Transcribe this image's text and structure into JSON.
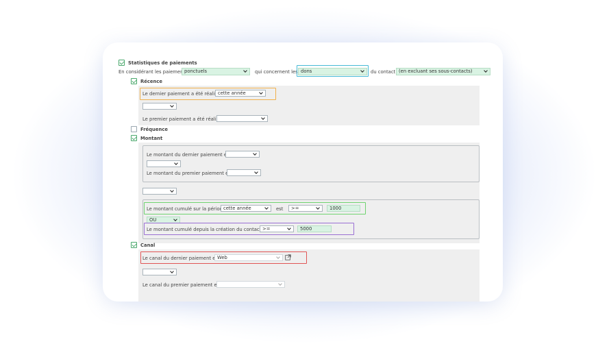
{
  "stats": {
    "title": "Statistiques de paiements",
    "checked": true
  },
  "filter": {
    "considering_label": "En considérant les paiements",
    "payments_value": "ponctuels",
    "concern_label": "qui concernent les",
    "concern_value": "dons",
    "contact_label": "du contact",
    "contact_value": "(en excluant ses sous-contacts)"
  },
  "recence": {
    "title": "Récence",
    "checked": true,
    "last_label": "Le dernier paiement a été réalisé",
    "last_value": "cette année",
    "op_value": "",
    "first_label": "Le premier paiement a été réalisé",
    "first_value": ""
  },
  "frequence": {
    "title": "Fréquence",
    "checked": false
  },
  "montant": {
    "title": "Montant",
    "checked": true,
    "last_label": "Le montant du dernier paiement est",
    "last_value": "",
    "op1_value": "",
    "first_label": "Le montant du premier paiement est",
    "first_value": "",
    "op2_value": "",
    "cumul_label": "Le montant cumulé sur la période",
    "cumul_period": "cette année",
    "est_label": "est",
    "cumul_op": ">=",
    "cumul_amount": "1000",
    "or_value": "OU",
    "creation_label": "Le montant cumulé depuis la création du contact est",
    "creation_op": ">=",
    "creation_amount": "5000"
  },
  "canal": {
    "title": "Canal",
    "checked": true,
    "last_label": "Le canal du dernier paiement est",
    "last_value": "Web",
    "op_value": "",
    "first_label": "Le canal du premier paiement est",
    "first_value": ""
  },
  "colors": {
    "orange": "#f0b04c",
    "teal": "#46b9d6",
    "green": "#6fd36f",
    "purple": "#9a6fd3",
    "red": "#e05555",
    "check_green": "#4aa86c"
  },
  "icons": [
    "checkbox-icon",
    "chevron-down-icon",
    "external-link-icon"
  ]
}
